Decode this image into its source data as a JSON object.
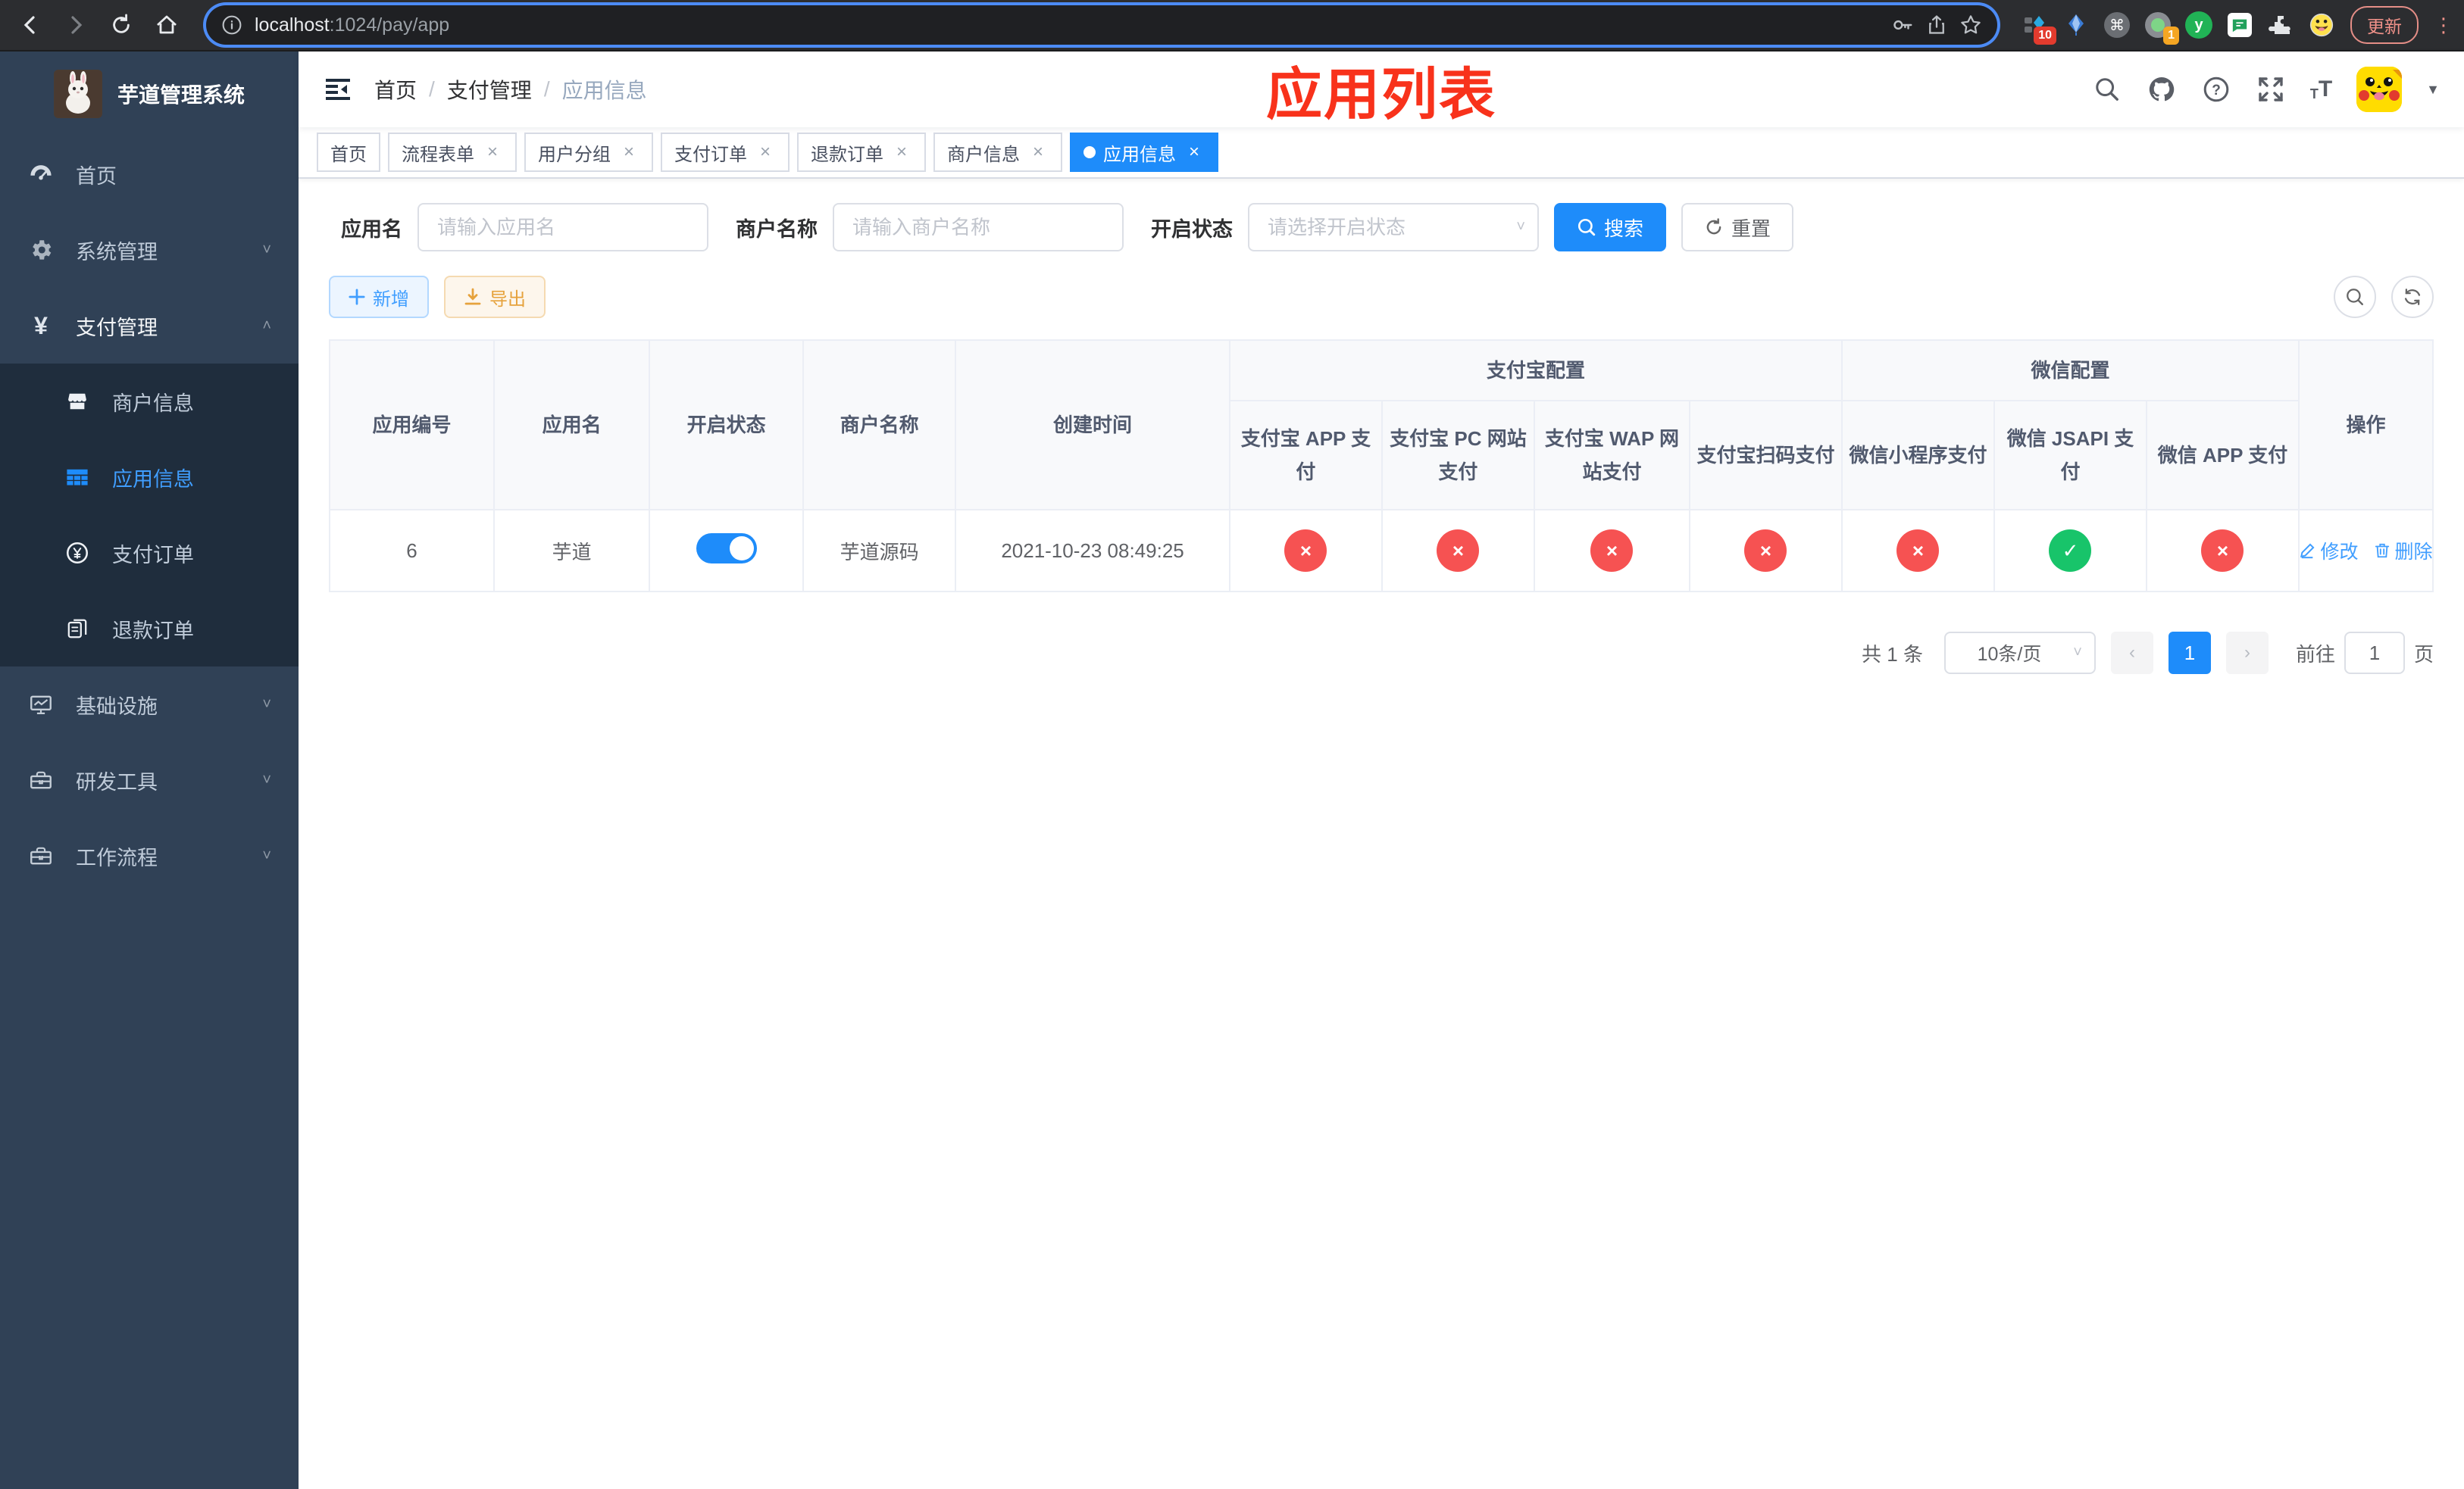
{
  "colors": {
    "accent": "#1e8cfa",
    "link": "#409eff",
    "danger": "#f65252",
    "success": "#18c46a",
    "annotation": "#f8321b",
    "sidebar_bg": "#304156",
    "submenu_bg": "#1f2d3d"
  },
  "browser": {
    "url_host": "localhost",
    "url_path": ":1024/pay/app",
    "update_label": "更新",
    "ext_badge_red": "10",
    "ext_badge_orange": "1",
    "ext_y_label": "y"
  },
  "sidebar": {
    "title": "芋道管理系统",
    "items": [
      {
        "label": "首页"
      },
      {
        "label": "系统管理"
      },
      {
        "label": "支付管理"
      },
      {
        "label": "商户信息"
      },
      {
        "label": "应用信息"
      },
      {
        "label": "支付订单"
      },
      {
        "label": "退款订单"
      },
      {
        "label": "基础设施"
      },
      {
        "label": "研发工具"
      },
      {
        "label": "工作流程"
      }
    ]
  },
  "header": {
    "breadcrumb": [
      "首页",
      "支付管理",
      "应用信息"
    ],
    "separator": "/",
    "overlay_title": "应用列表"
  },
  "tabs": [
    {
      "label": "首页",
      "closable": false,
      "active": false
    },
    {
      "label": "流程表单",
      "closable": true,
      "active": false
    },
    {
      "label": "用户分组",
      "closable": true,
      "active": false
    },
    {
      "label": "支付订单",
      "closable": true,
      "active": false
    },
    {
      "label": "退款订单",
      "closable": true,
      "active": false
    },
    {
      "label": "商户信息",
      "closable": true,
      "active": false
    },
    {
      "label": "应用信息",
      "closable": true,
      "active": true
    }
  ],
  "close_glyph": "×",
  "filters": {
    "app_name_label": "应用名",
    "app_name_placeholder": "请输入应用名",
    "merchant_label": "商户名称",
    "merchant_placeholder": "请输入商户名称",
    "status_label": "开启状态",
    "status_placeholder": "请选择开启状态",
    "search_label": "搜索",
    "reset_label": "重置"
  },
  "toolbar": {
    "add_label": "新增",
    "export_label": "导出"
  },
  "table": {
    "group_alipay": "支付宝配置",
    "group_wechat": "微信配置",
    "col_app_id": "应用编号",
    "col_app_name": "应用名",
    "col_status": "开启状态",
    "col_merchant": "商户名称",
    "col_create_time": "创建时间",
    "col_alipay_app": "支付宝 APP 支付",
    "col_alipay_pc": "支付宝 PC 网站支付",
    "col_alipay_wap": "支付宝 WAP 网站支付",
    "col_alipay_qr": "支付宝扫码支付",
    "col_wx_lite": "微信小程序支付",
    "col_wx_jsapi": "微信 JSAPI 支付",
    "col_wx_app": "微信 APP 支付",
    "col_actions": "操作",
    "glyph_on": "✓",
    "glyph_off": "×",
    "row": {
      "id": "6",
      "name": "芋道",
      "status_on": true,
      "merchant": "芋道源码",
      "create_time": "2021-10-23 08:49:25",
      "channels": [
        "off",
        "off",
        "off",
        "off",
        "off",
        "on",
        "off"
      ],
      "edit_label": "修改",
      "delete_label": "删除"
    }
  },
  "pagination": {
    "total_text": "共 1 条",
    "page_size": "10条/页",
    "current_page": "1",
    "goto_label": "前往",
    "goto_value": "1",
    "page_label": "页",
    "prev_glyph": "‹",
    "next_glyph": "›"
  }
}
